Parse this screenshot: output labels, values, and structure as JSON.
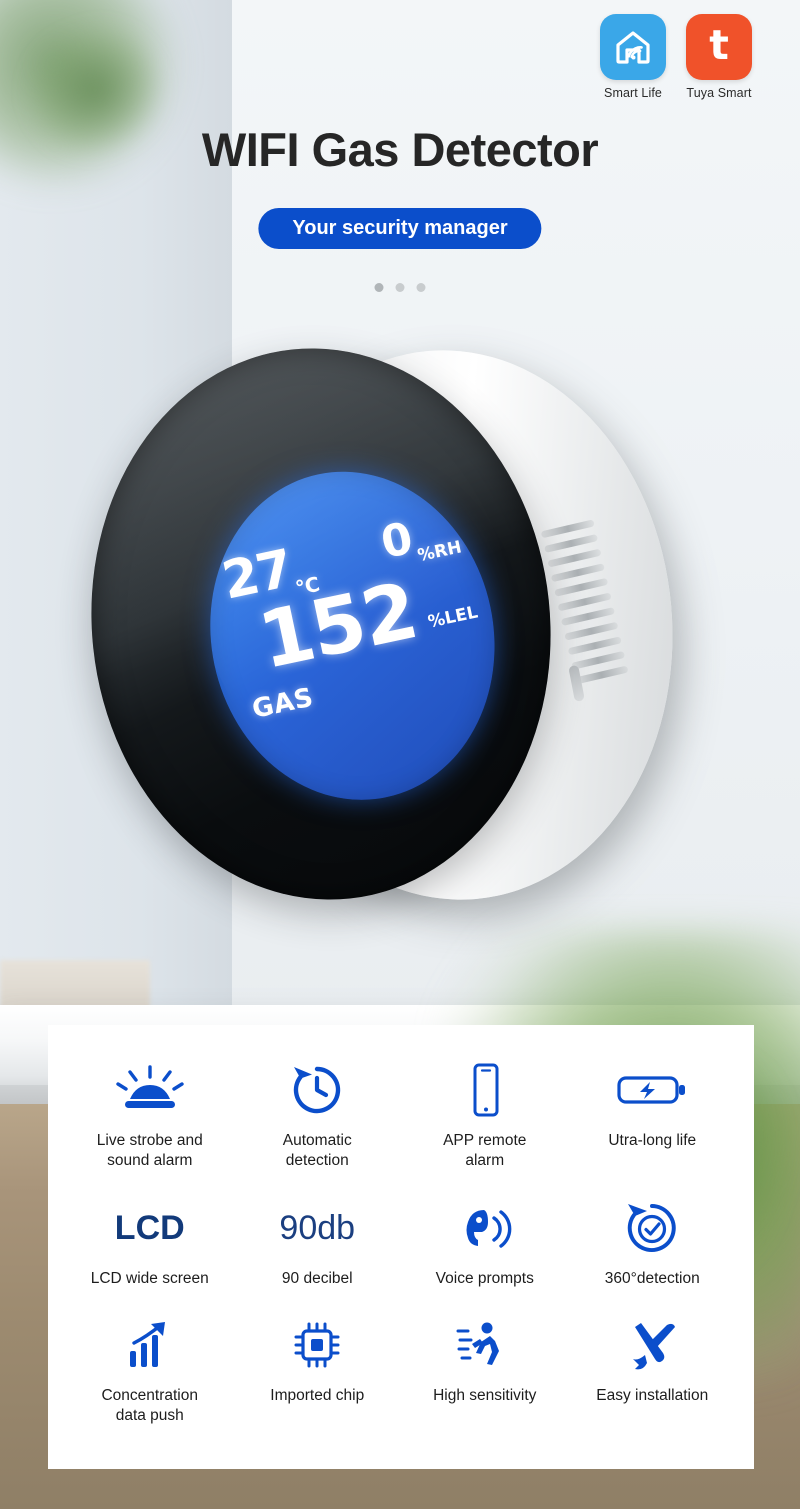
{
  "logos": [
    {
      "name": "smart-life",
      "caption": "Smart Life",
      "color": "#3aa7e8",
      "icon": "smart-home-wifi-icon"
    },
    {
      "name": "tuya-smart",
      "caption": "Tuya Smart",
      "color": "#f0522a",
      "icon": "tuya-t-icon",
      "glyph": "t"
    }
  ],
  "hero": {
    "title": "WIFI Gas Detector",
    "subtitle": "Your security manager",
    "dots": 3,
    "active_dot_index": 0
  },
  "device": {
    "display": {
      "temperature": "27",
      "temperature_unit": "℃",
      "humidity": "0",
      "humidity_unit": "%RH",
      "gas_value": "152",
      "gas_unit": "%LEL",
      "gas_label": "GAS"
    }
  },
  "features": [
    [
      {
        "icon": "strobe-alarm-icon",
        "label": "Live strobe and\nsound alarm"
      },
      {
        "icon": "clock-refresh-icon",
        "label": "Automatic\ndetection"
      },
      {
        "icon": "smartphone-icon",
        "label": "APP remote\nalarm"
      },
      {
        "icon": "battery-bolt-icon",
        "label": "Utra-long life"
      }
    ],
    [
      {
        "icon": "text-lcd",
        "big_text": "LCD",
        "label": "LCD wide screen",
        "bold": true
      },
      {
        "icon": "text-90db",
        "big_text": "90db",
        "label": "90 decibel",
        "bold": false
      },
      {
        "icon": "voice-prompt-icon",
        "label": "Voice prompts"
      },
      {
        "icon": "360-check-icon",
        "label": "360°detection"
      }
    ],
    [
      {
        "icon": "bar-chart-arrow-icon",
        "label": "Concentration\ndata push"
      },
      {
        "icon": "chip-icon",
        "label": "Imported chip"
      },
      {
        "icon": "running-person-icon",
        "label": "High sensitivity"
      },
      {
        "icon": "tools-icon",
        "label": "Easy installation"
      }
    ]
  ],
  "colors": {
    "accent_blue": "#0b4ecb",
    "smart_life_blue": "#3aa7e8",
    "tuya_orange": "#f0522a",
    "screen_blue": "#2a6fe0"
  }
}
